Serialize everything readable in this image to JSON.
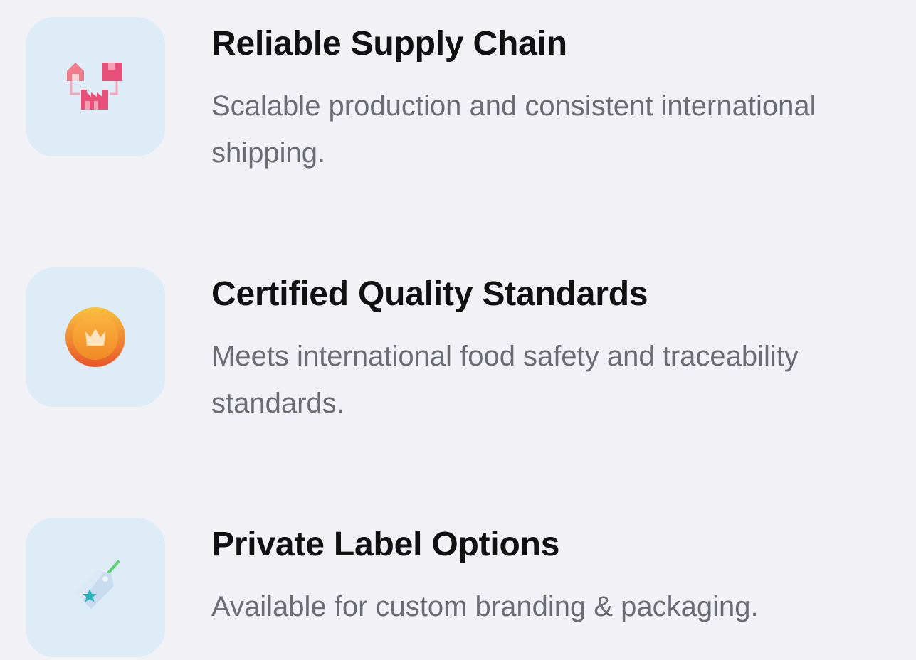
{
  "features": [
    {
      "title": "Reliable Supply Chain",
      "description": "Scalable production and consistent international shipping.",
      "icon": "supply-chain-icon"
    },
    {
      "title": "Certified Quality Standards",
      "description": "Meets international food safety and traceability standards.",
      "icon": "quality-medal-icon"
    },
    {
      "title": "Private Label Options",
      "description": "Available for custom branding & packaging.",
      "icon": "price-tag-icon"
    }
  ],
  "colors": {
    "background": "#f1f1f6",
    "icon_box": "#ddecf6",
    "title": "#111111",
    "description": "#6b6b72",
    "supply_icon": "#e8507a",
    "medal_icon": "#f08a24",
    "tag_icon": "#2bb3c0"
  }
}
